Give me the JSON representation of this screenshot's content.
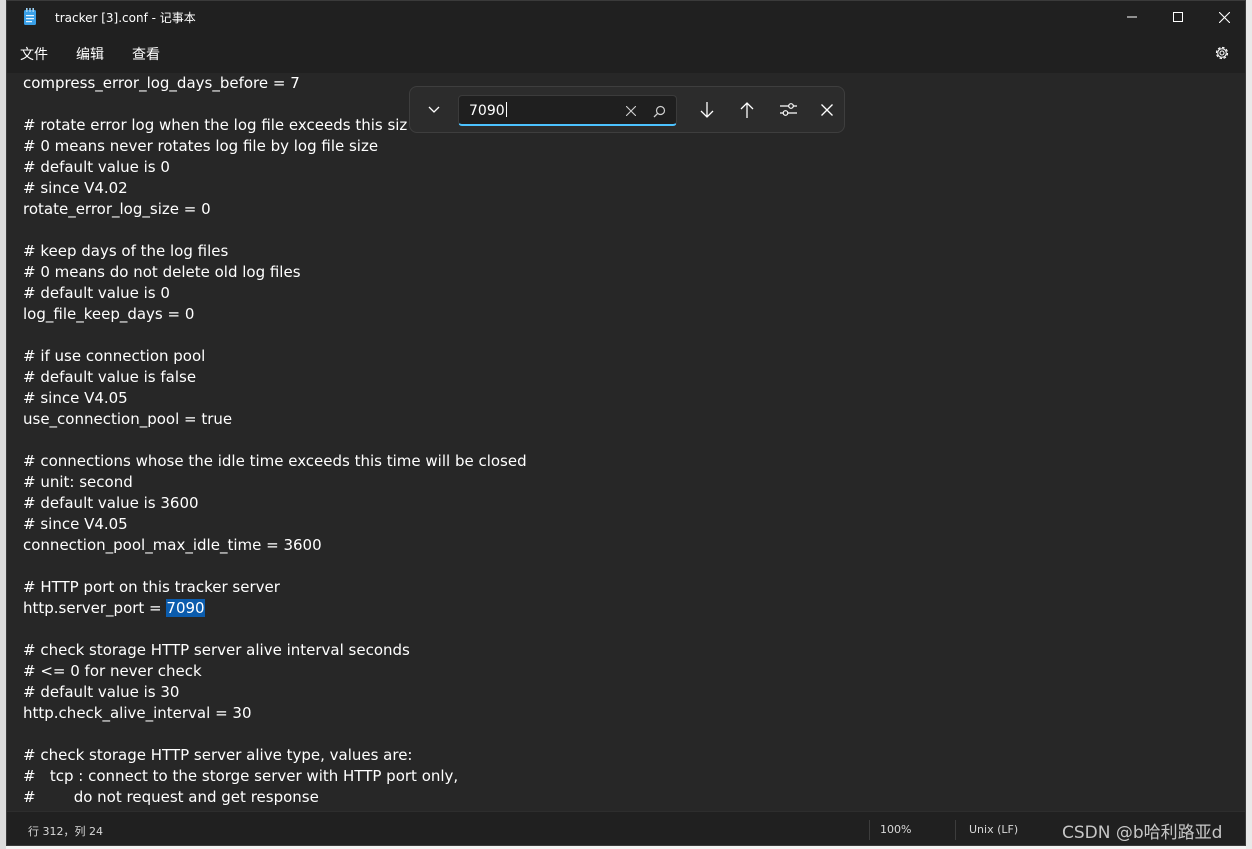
{
  "window": {
    "title": "tracker [3].conf - 记事本",
    "app_icon": "notepad-icon",
    "controls": [
      "minimize-icon",
      "maximize-icon",
      "close-icon"
    ]
  },
  "menu": {
    "file": "文件",
    "edit": "编辑",
    "view": "查看",
    "settings_icon": "gear-icon"
  },
  "find": {
    "value": "7090",
    "buttons": [
      "chevron-down-icon",
      "clear-icon",
      "search-icon",
      "arrow-down-icon",
      "arrow-up-icon",
      "options-icon",
      "close-icon"
    ]
  },
  "editor": {
    "lines": [
      "compress_error_log_days_before = 7",
      "",
      "# rotate error log when the log file exceeds this siz",
      "# 0 means never rotates log file by log file size",
      "# default value is 0",
      "# since V4.02",
      "rotate_error_log_size = 0",
      "",
      "# keep days of the log files",
      "# 0 means do not delete old log files",
      "# default value is 0",
      "log_file_keep_days = 0",
      "",
      "# if use connection pool",
      "# default value is false",
      "# since V4.05",
      "use_connection_pool = true",
      "",
      "# connections whose the idle time exceeds this time will be closed",
      "# unit: second",
      "# default value is 3600",
      "# since V4.05",
      "connection_pool_max_idle_time = 3600",
      "",
      "# HTTP port on this tracker server",
      "http.server_port = ",
      "",
      "# check storage HTTP server alive interval seconds",
      "# <= 0 for never check",
      "# default value is 30",
      "http.check_alive_interval = 30",
      "",
      "# check storage HTTP server alive type, values are:",
      "#   tcp : connect to the storge server with HTTP port only,",
      "#        do not request and get response"
    ],
    "highlight_text": "7090"
  },
  "status": {
    "position": "行 312，列 24",
    "zoom": "100%",
    "line_ending": "Unix (LF)"
  },
  "watermark": "CSDN @b哈利路亚d"
}
